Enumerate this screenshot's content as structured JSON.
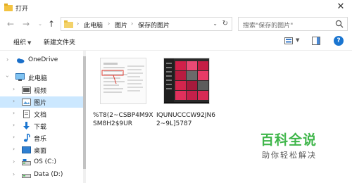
{
  "window": {
    "title": "打开"
  },
  "address_bar": {
    "crumbs": [
      "此电脑",
      "图片",
      "保存的图片"
    ]
  },
  "search": {
    "placeholder": "搜索\"保存的图片\""
  },
  "toolbar": {
    "organize_label": "组织",
    "new_folder_label": "新建文件夹"
  },
  "sidebar": {
    "items": [
      {
        "label": "OneDrive",
        "icon": "cloud-icon",
        "expandable": true
      },
      {
        "label": "此电脑",
        "icon": "computer-icon",
        "expandable": true,
        "expanded": true
      },
      {
        "label": "视频",
        "icon": "video-icon",
        "expandable": true
      },
      {
        "label": "图片",
        "icon": "pictures-icon",
        "expandable": true,
        "selected": true
      },
      {
        "label": "文档",
        "icon": "documents-icon",
        "expandable": true
      },
      {
        "label": "下载",
        "icon": "download-icon",
        "expandable": true
      },
      {
        "label": "音乐",
        "icon": "music-icon",
        "expandable": true
      },
      {
        "label": "桌面",
        "icon": "desktop-icon",
        "expandable": true
      },
      {
        "label": "OS (C:)",
        "icon": "drive-icon",
        "expandable": true
      },
      {
        "label": "Data (D:)",
        "icon": "drive-icon",
        "expandable": true
      }
    ]
  },
  "files": [
    {
      "name": "%T8(2~CSBP4M9XSM8H2$9UR"
    },
    {
      "name": "IQUNUCCCW92JN62~9L]5787"
    }
  ],
  "watermark": {
    "main": "百科全说",
    "sub": "助你轻松解决"
  },
  "colors": {
    "selection": "#cce8ff",
    "accent": "#1a75d0",
    "folder": "#f3c340",
    "watermark": "#3fb64a"
  }
}
